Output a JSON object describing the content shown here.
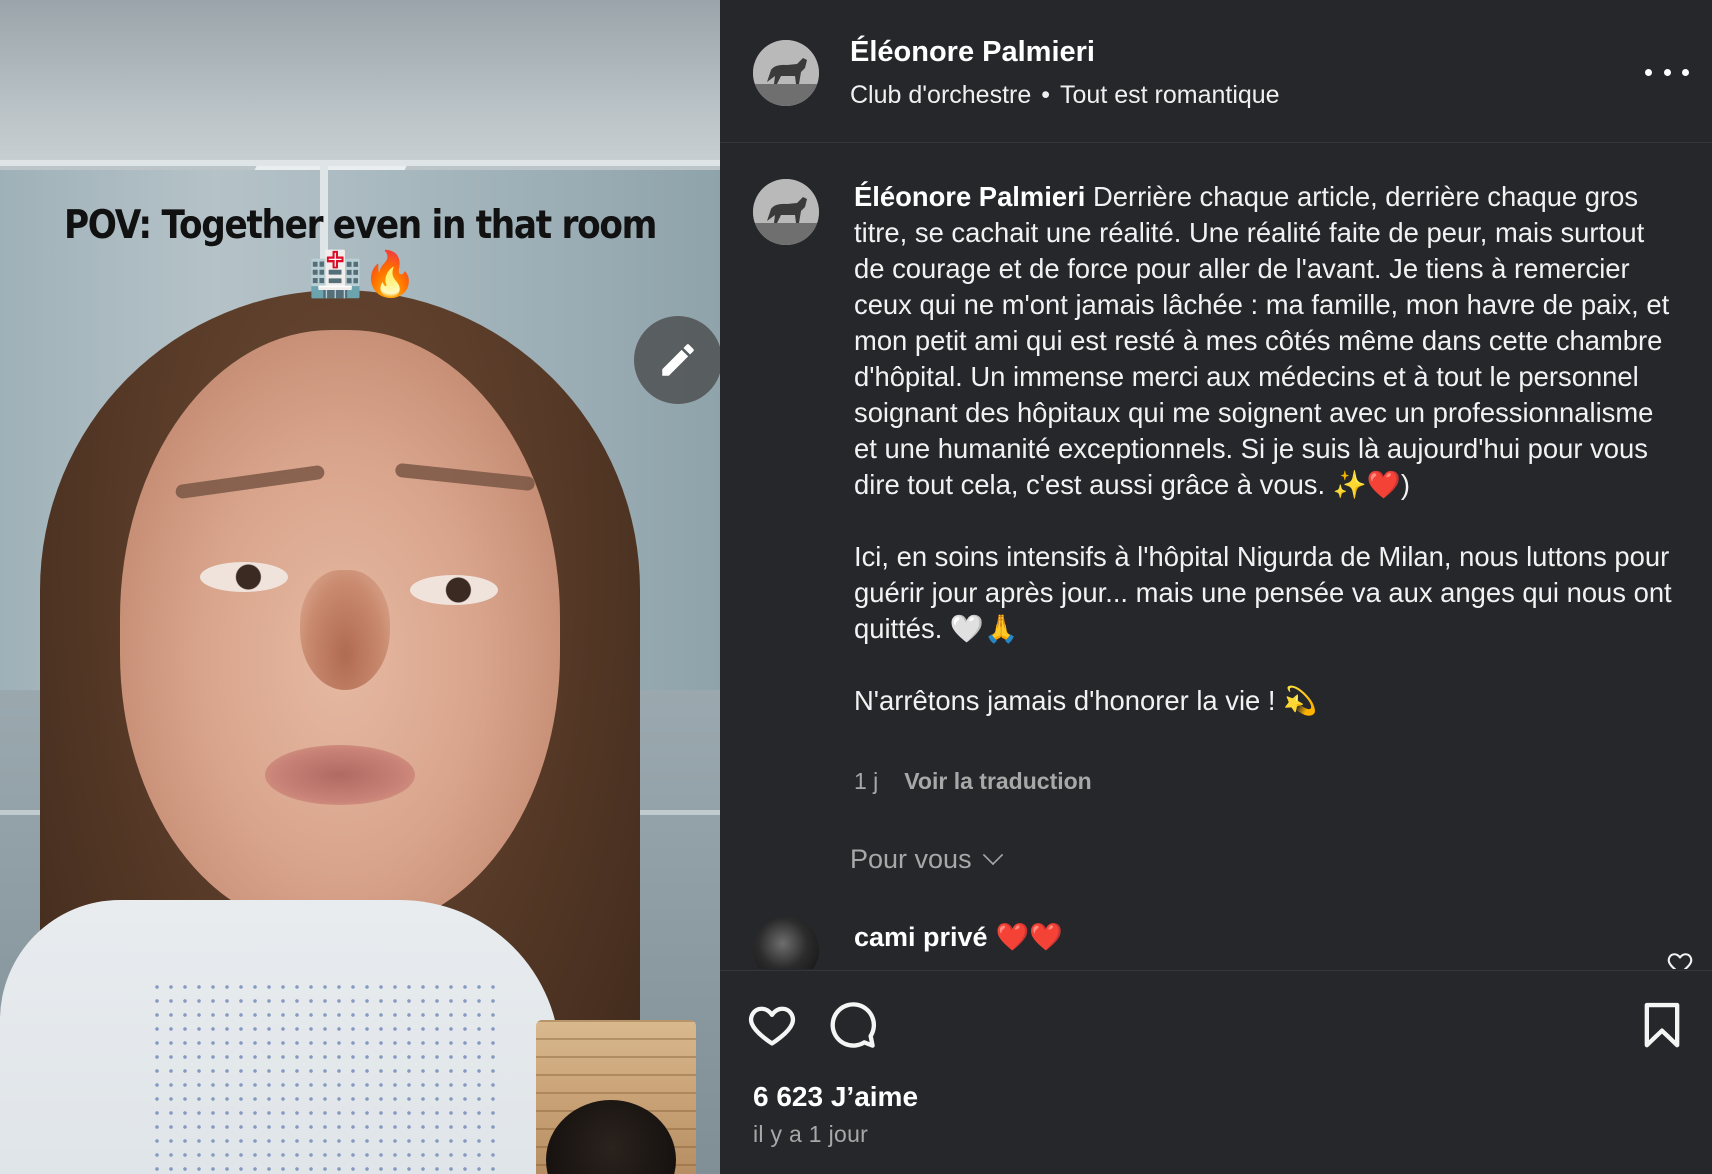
{
  "media": {
    "overlay_caption": "POV: Together even in that room",
    "overlay_emoji": "🏥🔥",
    "edit_icon": "pencil-icon"
  },
  "header": {
    "username": "Éléonore Palmieri",
    "audio_artist": "Club d'orchestre",
    "separator": "•",
    "audio_track": "Tout est romantique",
    "more_icon": "more-horizontal-icon"
  },
  "post": {
    "author": "Éléonore Palmieri",
    "paragraphs": [
      "Derrière chaque article, derrière chaque gros titre, se cachait une réalité. Une réalité faite de peur, mais surtout de courage et de force pour aller de l'avant. Je tiens à remercier ceux qui ne m'ont jamais lâchée : ma famille, mon havre de paix, et mon petit ami qui est resté à mes côtés même dans cette chambre d'hôpital. Un immense merci aux médecins et à tout le personnel soignant des hôpitaux qui me soignent avec un professionnalisme et une humanité exceptionnels. Si je suis là aujourd'hui pour vous dire tout cela, c'est aussi grâce à vous. ✨❤️)",
      "Ici, en soins intensifs à l'hôpital Nigurda de Milan, nous luttons pour guérir jour après jour... mais une pensée va aux anges qui nous ont quittés. 🤍🙏",
      "N'arrêtons jamais d'honorer la vie ! 💫"
    ],
    "age": "1 j",
    "translate_label": "Voir la traduction"
  },
  "for_you": {
    "label": "Pour vous"
  },
  "comment": {
    "username": "cami privé",
    "emoji": "❤️❤️",
    "like_icon": "heart-outline-icon"
  },
  "actions": {
    "like_icon": "heart-outline-icon",
    "comment_icon": "comment-bubble-icon",
    "save_icon": "bookmark-icon",
    "likes_text": "6 623 J’aime",
    "timestamp": "il y a 1 jour"
  },
  "colors": {
    "panel_bg": "#25272b",
    "text_primary": "#f2f2f2",
    "text_secondary": "#a8a8a8"
  }
}
